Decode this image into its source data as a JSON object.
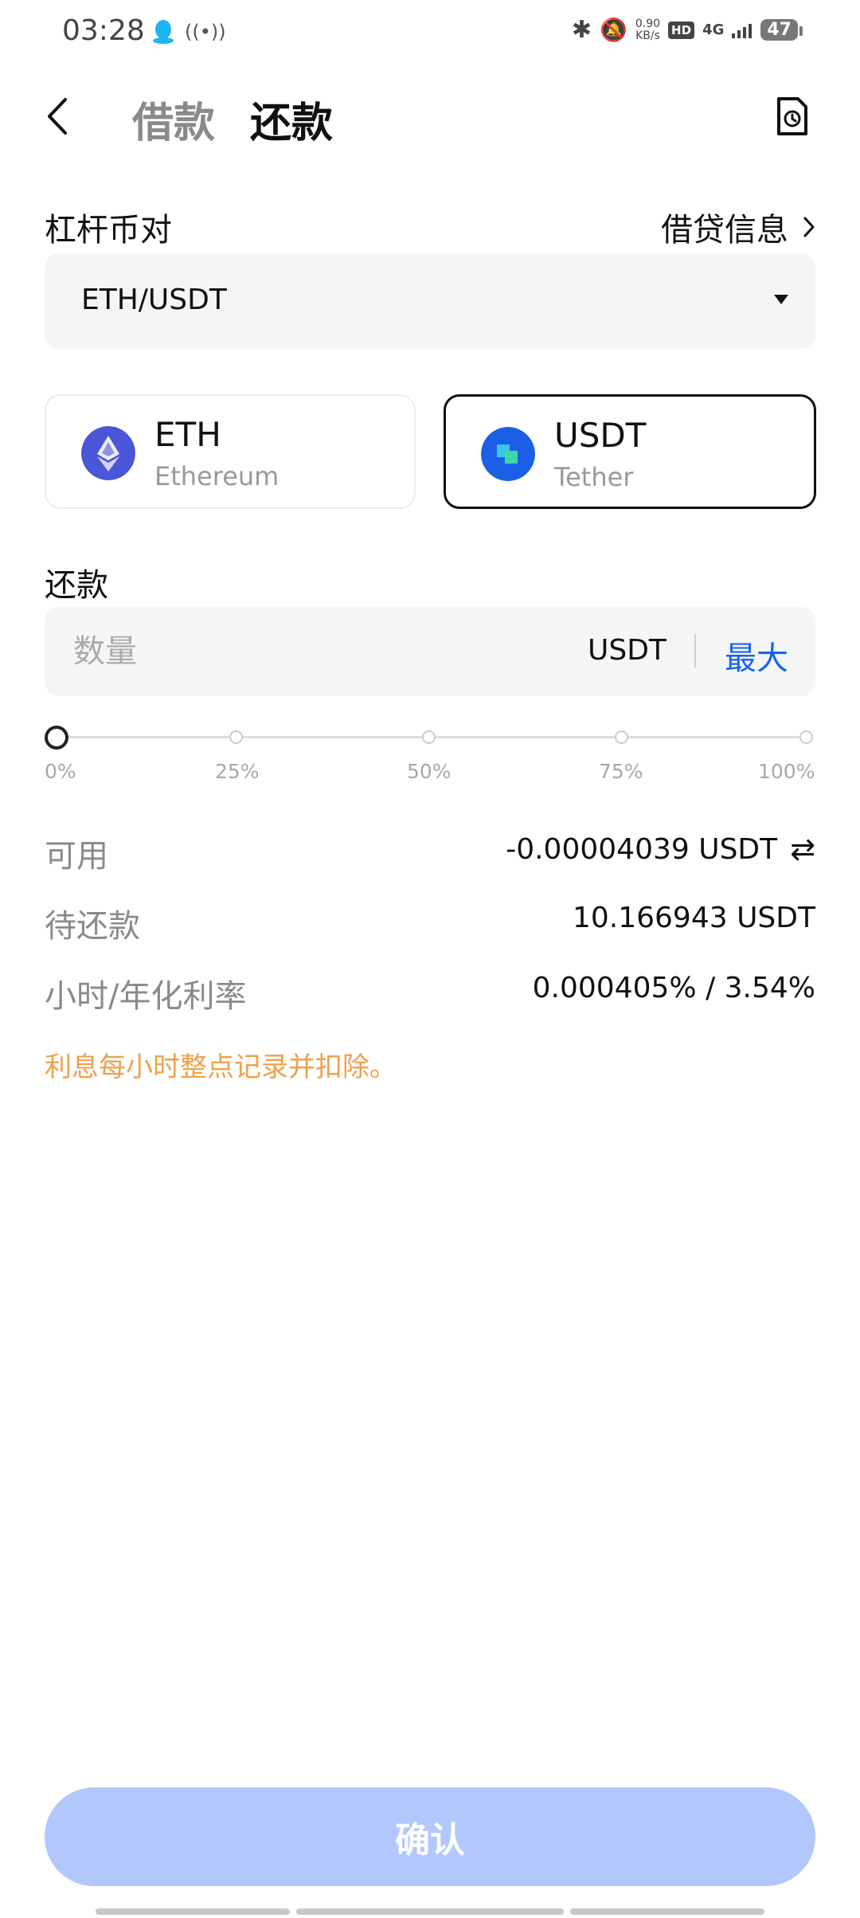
{
  "status_bar": {
    "time": "03:28",
    "speed_value": "0.90",
    "speed_unit": "KB/s",
    "hd": "HD",
    "network": "4G",
    "battery": "47"
  },
  "header": {
    "tabs": [
      {
        "label": "借款",
        "active": false
      },
      {
        "label": "还款",
        "active": true
      }
    ]
  },
  "pair": {
    "label": "杠杆币对",
    "info_link": "借贷信息",
    "selected": "ETH/USDT"
  },
  "coins": [
    {
      "symbol": "ETH",
      "name": "Ethereum",
      "selected": false,
      "color": "#627eea"
    },
    {
      "symbol": "USDT",
      "name": "Tether",
      "selected": true,
      "color": "#1764e8"
    }
  ],
  "repay": {
    "label": "还款",
    "placeholder": "数量",
    "unit": "USDT",
    "max_label": "最大"
  },
  "slider": {
    "value_percent": 0,
    "marks": [
      "0%",
      "25%",
      "50%",
      "75%",
      "100%"
    ]
  },
  "info": {
    "available_label": "可用",
    "available_value": "-0.00004039 USDT",
    "pending_label": "待还款",
    "pending_value": "10.166943 USDT",
    "rate_label": "小时/年化利率",
    "rate_value": "0.000405% / 3.54%"
  },
  "notice": "利息每小时整点记录并扣除。",
  "confirm_label": "确认",
  "colors": {
    "accent": "#1764e8",
    "confirm_disabled": "#b2c8fc",
    "notice": "#f0a04b"
  }
}
